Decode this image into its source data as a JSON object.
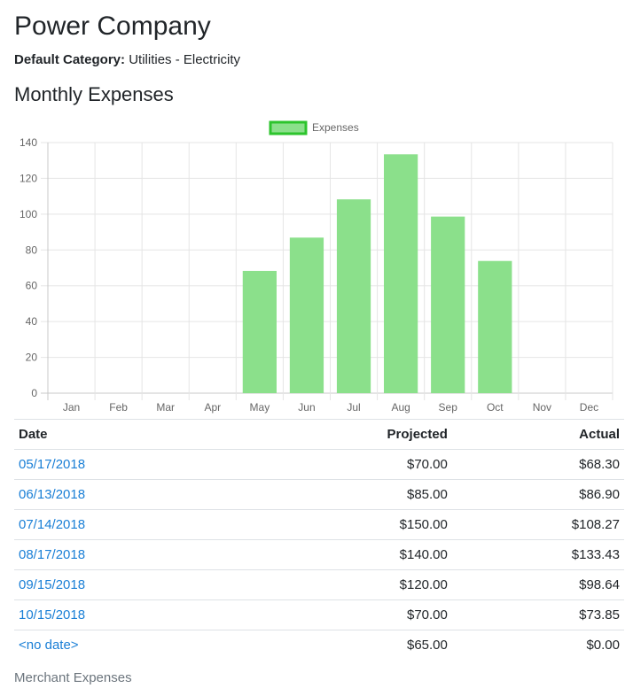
{
  "header": {
    "title": "Power Company",
    "category_label": "Default Category:",
    "category_value": "Utilities - Electricity"
  },
  "section": {
    "title": "Monthly Expenses"
  },
  "colors": {
    "bar_fill": "#8be08b",
    "bar_border": "#2cc42c",
    "link": "#1a7fd6",
    "grid": "#e5e5e5"
  },
  "chart_data": {
    "type": "bar",
    "categories": [
      "Jan",
      "Feb",
      "Mar",
      "Apr",
      "May",
      "Jun",
      "Jul",
      "Aug",
      "Sep",
      "Oct",
      "Nov",
      "Dec"
    ],
    "series": [
      {
        "name": "Expenses",
        "values": [
          0,
          0,
          0,
          0,
          68.3,
          86.9,
          108.27,
          133.43,
          98.64,
          73.85,
          0,
          0
        ]
      }
    ],
    "ylim": [
      0,
      140
    ],
    "yticks": [
      "0",
      "20",
      "40",
      "60",
      "80",
      "100",
      "120",
      "140"
    ],
    "legend": "top-center",
    "grid": true
  },
  "table": {
    "headers": {
      "date": "Date",
      "projected": "Projected",
      "actual": "Actual"
    },
    "rows": [
      {
        "date": "05/17/2018",
        "projected": "$70.00",
        "actual": "$68.30"
      },
      {
        "date": "06/13/2018",
        "projected": "$85.00",
        "actual": "$86.90"
      },
      {
        "date": "07/14/2018",
        "projected": "$150.00",
        "actual": "$108.27"
      },
      {
        "date": "08/17/2018",
        "projected": "$140.00",
        "actual": "$133.43"
      },
      {
        "date": "09/15/2018",
        "projected": "$120.00",
        "actual": "$98.64"
      },
      {
        "date": "10/15/2018",
        "projected": "$70.00",
        "actual": "$73.85"
      },
      {
        "date": "<no date>",
        "projected": "$65.00",
        "actual": "$0.00"
      }
    ]
  },
  "footer": {
    "merchant_link": "Merchant Expenses"
  }
}
